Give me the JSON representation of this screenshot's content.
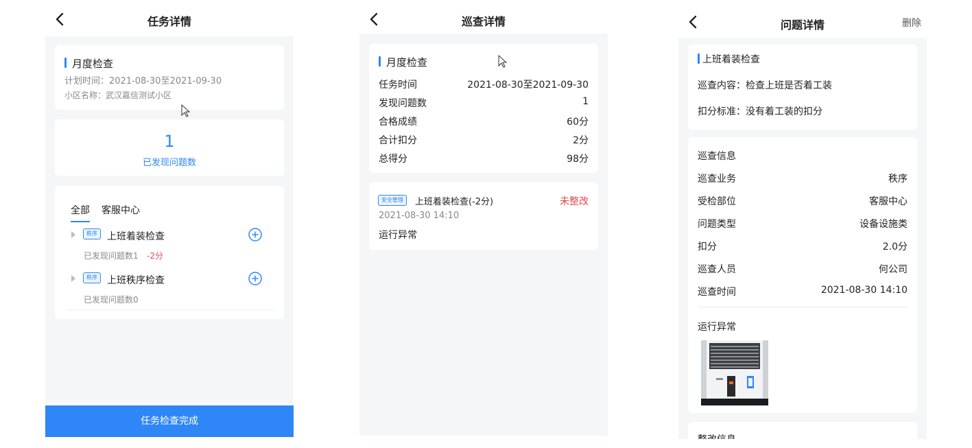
{
  "colors": {
    "accent": "#2f86f6",
    "danger": "#e5484d",
    "background": "#f5f6f8"
  },
  "task_detail": {
    "nav_title": "任务详情",
    "plan": {
      "title": "月度检查",
      "plan_time": "计划时间：2021-08-30至2021-09-30",
      "community": "小区名称：武汉嘉信测试小区"
    },
    "summary": {
      "count": "1",
      "label": "已发现问题数"
    },
    "tabs": [
      "全部",
      "客服中心"
    ],
    "items": [
      {
        "tag": "秩序",
        "title": "上班着装检查",
        "found": "已发现问题数1",
        "deduct": "-2分"
      },
      {
        "tag": "秩序",
        "title": "上班秩序检查",
        "found": "已发现问题数0",
        "deduct": ""
      }
    ],
    "complete_button": "任务检查完成"
  },
  "patrol_detail": {
    "nav_title": "巡查详情",
    "title": "月度检查",
    "rows": [
      {
        "label": "任务时间",
        "value": "2021-08-30至2021-09-30"
      },
      {
        "label": "发现问题数",
        "value": "1"
      },
      {
        "label": "合格成绩",
        "value": "60分"
      },
      {
        "label": "合计扣分",
        "value": "2分"
      },
      {
        "label": "总得分",
        "value": "98分"
      }
    ],
    "issue": {
      "tag": "安全管理",
      "title": "上班着装检查(-2分)",
      "status": "未整改",
      "time": "2021-08-30 14:10",
      "desc": "运行异常"
    }
  },
  "issue_detail": {
    "nav_title": "问题详情",
    "delete_label": "删除",
    "header": {
      "title": "上班着装检查",
      "content": "巡查内容：检查上班是否着工装",
      "standard": "扣分标准：没有着工装的扣分"
    },
    "info": {
      "title": "巡查信息",
      "rows": [
        {
          "label": "巡查业务",
          "value": "秩序"
        },
        {
          "label": "受检部位",
          "value": "客服中心"
        },
        {
          "label": "问题类型",
          "value": "设备设施类"
        },
        {
          "label": "扣分",
          "value": "2.0分"
        },
        {
          "label": "巡查人员",
          "value": "何公司"
        },
        {
          "label": "巡查时间",
          "value": "2021-08-30 14:10"
        }
      ],
      "desc": "运行异常"
    },
    "rectify_title": "整改信息"
  }
}
